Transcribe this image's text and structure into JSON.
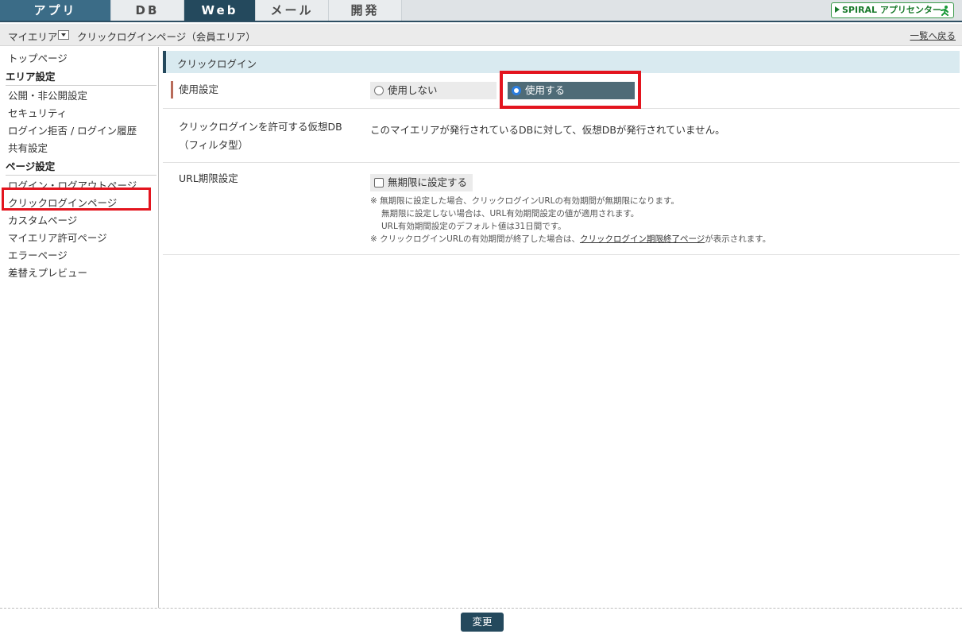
{
  "tabs": [
    {
      "label": "アプリ"
    },
    {
      "label": "DB"
    },
    {
      "label": "Web"
    },
    {
      "label": "メール"
    },
    {
      "label": "開発"
    }
  ],
  "logo_text": "SPIRAL アプリセンター",
  "breadcrumb": {
    "area": "マイエリア",
    "page": "クリックログインページ（会員エリア）",
    "back_link": "一覧へ戻る"
  },
  "sidebar": {
    "top": "トップページ",
    "area_settings_heading": "エリア設定",
    "area_items": [
      "公開・非公開設定",
      "セキュリティ",
      "ログイン拒否 / ログイン履歴",
      "共有設定"
    ],
    "page_settings_heading": "ページ設定",
    "page_items": [
      "ログイン・ログアウトページ",
      "クリックログインページ",
      "カスタムページ",
      "マイエリア許可ページ",
      "エラーページ",
      "差替えプレビュー"
    ]
  },
  "section": {
    "title": "クリックログイン"
  },
  "usage": {
    "label": "使用設定",
    "option_off": "使用しない",
    "option_on": "使用する",
    "selected": "使用する"
  },
  "virtual_db": {
    "label_line1": "クリックログインを許可する仮想DB",
    "label_line2": "（フィルタ型）",
    "value": "このマイエリアが発行されているDBに対して、仮想DBが発行されていません。"
  },
  "url_expiry": {
    "label": "URL期限設定",
    "checkbox_label": "無期限に設定する",
    "checked": false,
    "note1": "※ 無期限に設定した場合、クリックログインURLの有効期間が無期限になります。",
    "note2": "無期限に設定しない場合は、URL有効期間設定の値が適用されます。",
    "note3": "URL有効期間設定のデフォルト値は31日間です。",
    "note4_pre": "※ クリックログインURLの有効期間が終了した場合は、",
    "note4_link": "クリックログイン期限終了ページ",
    "note4_post": "が表示されます。"
  },
  "footer": {
    "submit_label": "変更"
  }
}
